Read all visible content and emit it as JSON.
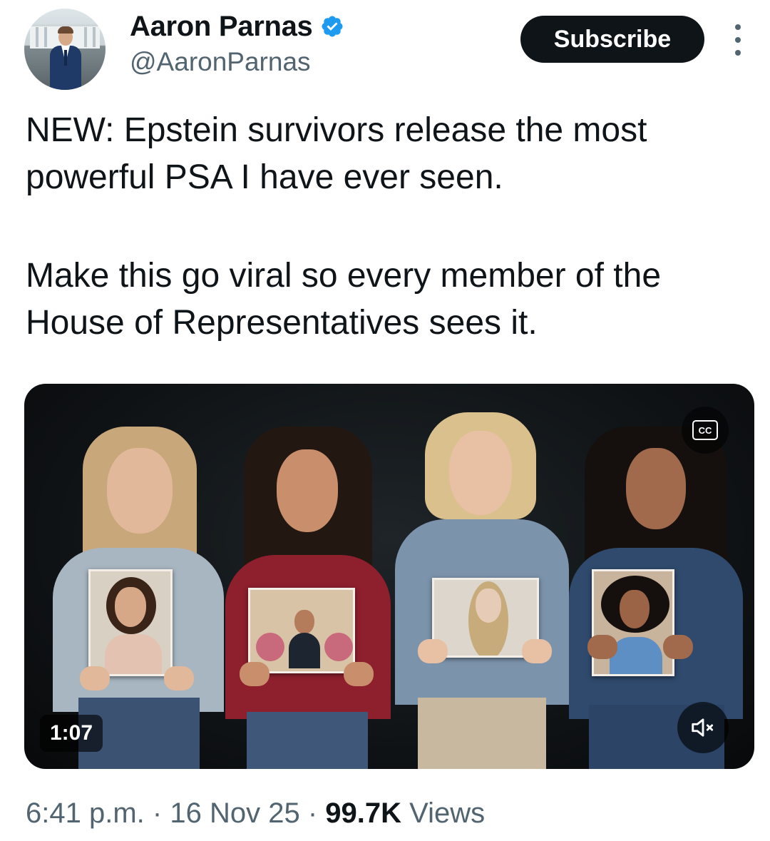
{
  "author": {
    "display_name": "Aaron Parnas",
    "handle": "@AaronParnas",
    "verified": true,
    "verified_color": "#1d9bf0"
  },
  "actions": {
    "subscribe_label": "Subscribe"
  },
  "tweet": {
    "paragraph_1": "NEW: Epstein survivors release the most powerful PSA I have ever seen.",
    "paragraph_2": "Make this go viral so every member of the House of Representatives sees it."
  },
  "media": {
    "type": "video",
    "duration": "1:07",
    "captions_label": "CC",
    "muted": true
  },
  "meta": {
    "time": "6:41 p.m.",
    "separator": "·",
    "date": "16 Nov 25",
    "views_count": "99.7K",
    "views_label": "Views"
  },
  "icons": [
    "verified-badge-icon",
    "more-options-icon",
    "closed-captions-icon",
    "muted-speaker-icon"
  ]
}
